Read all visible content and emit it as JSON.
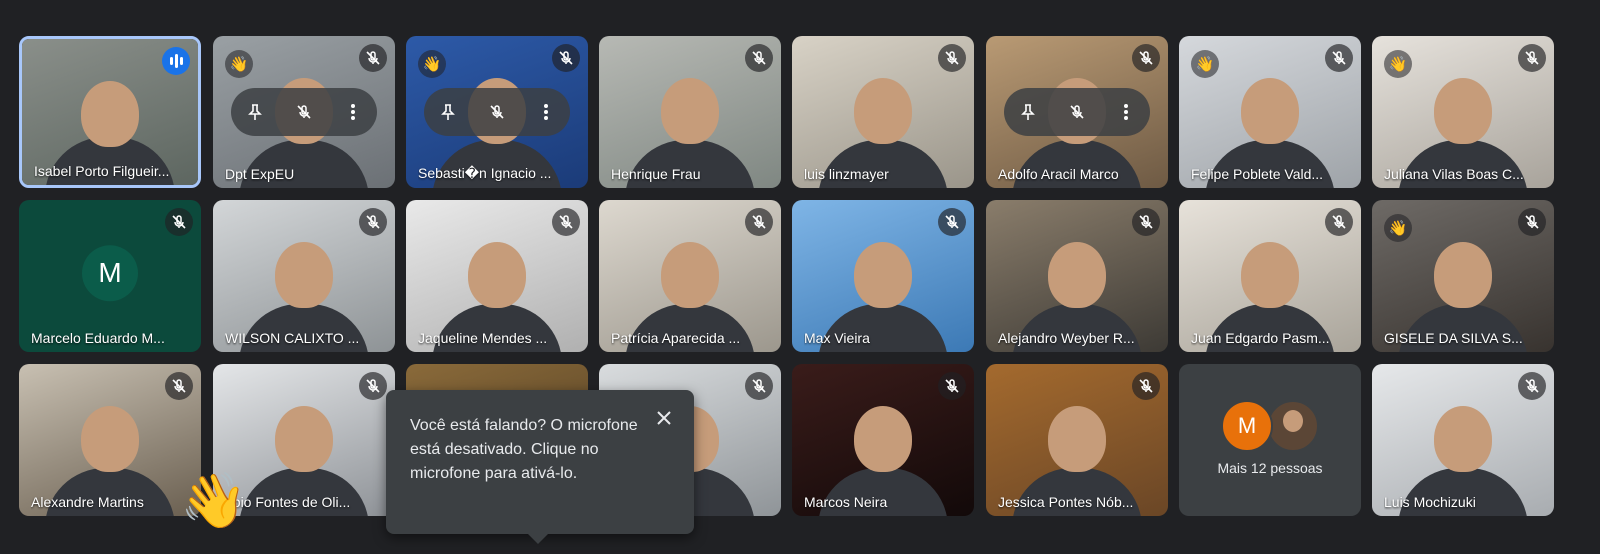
{
  "icons": {
    "mic_off": "mic-off-icon",
    "raised_hand": "raised-hand-icon",
    "speaking": "audio-level-icon",
    "pin": "pin-icon",
    "more": "more-vert-icon",
    "close": "close-icon",
    "reaction_wave": "waving-hand-icon"
  },
  "colors": {
    "background": "#202124",
    "active_border": "#a8c7fa",
    "speaking_indicator": "#1a73e8",
    "tooltip_bg": "#3c4043"
  },
  "grid": {
    "participants": [
      {
        "name": "Isabel Porto Filgueir...",
        "raised_hand": false,
        "speaking": true,
        "active": true
      },
      {
        "name": "Dpt ExpEU",
        "raised_hand": true,
        "muted": true,
        "hover_controls": true
      },
      {
        "name": "Sebasti�n Ignacio ...",
        "raised_hand": true,
        "muted": true,
        "hover_controls": true
      },
      {
        "name": "Henrique Frau",
        "muted": true
      },
      {
        "name": "luis linzmayer",
        "muted": true
      },
      {
        "name": "Adolfo Aracil Marco",
        "muted": true,
        "hover_controls": true
      },
      {
        "name": "Felipe Poblete Vald...",
        "raised_hand": true,
        "muted": true
      },
      {
        "name": "Juliana Vilas Boas C...",
        "raised_hand": true,
        "muted": true
      },
      {
        "name": "Marcelo Eduardo M...",
        "muted": true,
        "avatar_letter": "M"
      },
      {
        "name": "WILSON CALIXTO ...",
        "muted": true
      },
      {
        "name": "Jaqueline Mendes ...",
        "muted": true
      },
      {
        "name": "Patrícia Aparecida ...",
        "muted": true
      },
      {
        "name": "Max Vieira",
        "muted": true
      },
      {
        "name": "Alejandro Weyber R...",
        "muted": true
      },
      {
        "name": "Juan Edgardo Pasm...",
        "muted": true
      },
      {
        "name": "GISELE DA SILVA S...",
        "raised_hand": true,
        "muted": true
      },
      {
        "name": "Alexandre Martins",
        "muted": true
      },
      {
        "name": "abio Fontes de Oli...",
        "muted": true
      },
      {
        "name": "",
        "muted": false
      },
      {
        "name": "eira",
        "muted": true
      },
      {
        "name": "Marcos Neira",
        "muted": true
      },
      {
        "name": "Jessica Pontes Nób...",
        "muted": true
      },
      {
        "name": "",
        "more_people": true
      },
      {
        "name": "Luis Mochizuki",
        "muted": true
      }
    ],
    "more_people": {
      "avatar_letter": "M",
      "label": "Mais 12 pessoas"
    }
  },
  "tooltip": {
    "text": "Você está falando? O microfone está desativado. Clique no microfone para ativá-lo."
  }
}
